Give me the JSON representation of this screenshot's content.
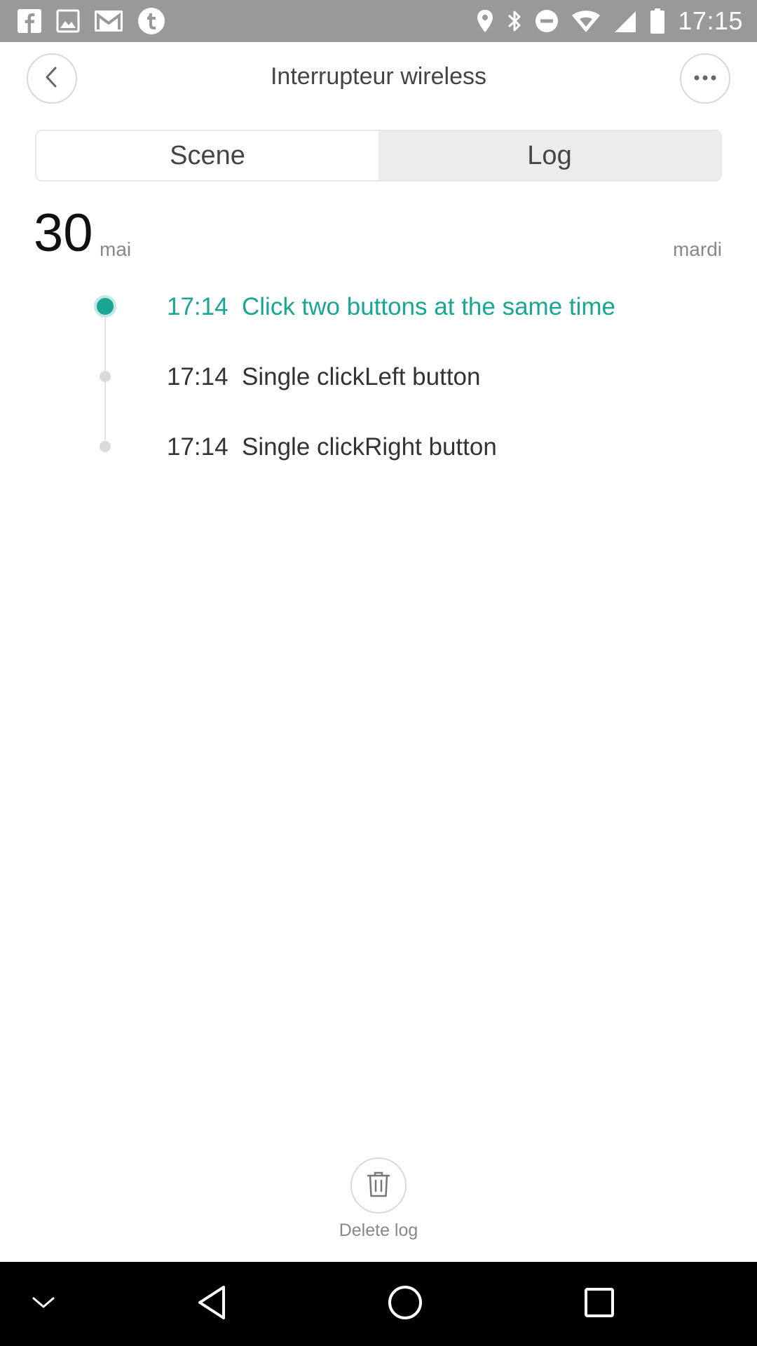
{
  "status_bar": {
    "time": "17:15",
    "left_icons": [
      "facebook-icon",
      "gallery-icon",
      "gmail-icon",
      "tumblr-icon"
    ],
    "right_icons": [
      "location-icon",
      "bluetooth-icon",
      "do-not-disturb-icon",
      "wifi-icon",
      "signal-icon",
      "battery-icon"
    ]
  },
  "header": {
    "title": "Interrupteur wireless",
    "back_icon": "chevron-left-icon",
    "more_icon": "more-horizontal-icon"
  },
  "tabs": [
    {
      "label": "Scene",
      "active": false
    },
    {
      "label": "Log",
      "active": true
    }
  ],
  "date_header": {
    "day": "30",
    "month": "mai",
    "weekday": "mardi"
  },
  "log_entries": [
    {
      "time": "17:14",
      "text": "Click two buttons at the same time",
      "active": true
    },
    {
      "time": "17:14",
      "text": "Single clickLeft button",
      "active": false
    },
    {
      "time": "17:14",
      "text": "Single clickRight button",
      "active": false
    }
  ],
  "delete": {
    "label": "Delete log",
    "icon": "trash-icon"
  },
  "nav_bar": {
    "icons": [
      "chevron-down-icon",
      "back-triangle-icon",
      "home-circle-icon",
      "recents-square-icon"
    ]
  },
  "colors": {
    "accent": "#1aa595",
    "status_bar": "#999999",
    "nav_bar": "#000000",
    "active_tab_bg": "#ececec"
  }
}
